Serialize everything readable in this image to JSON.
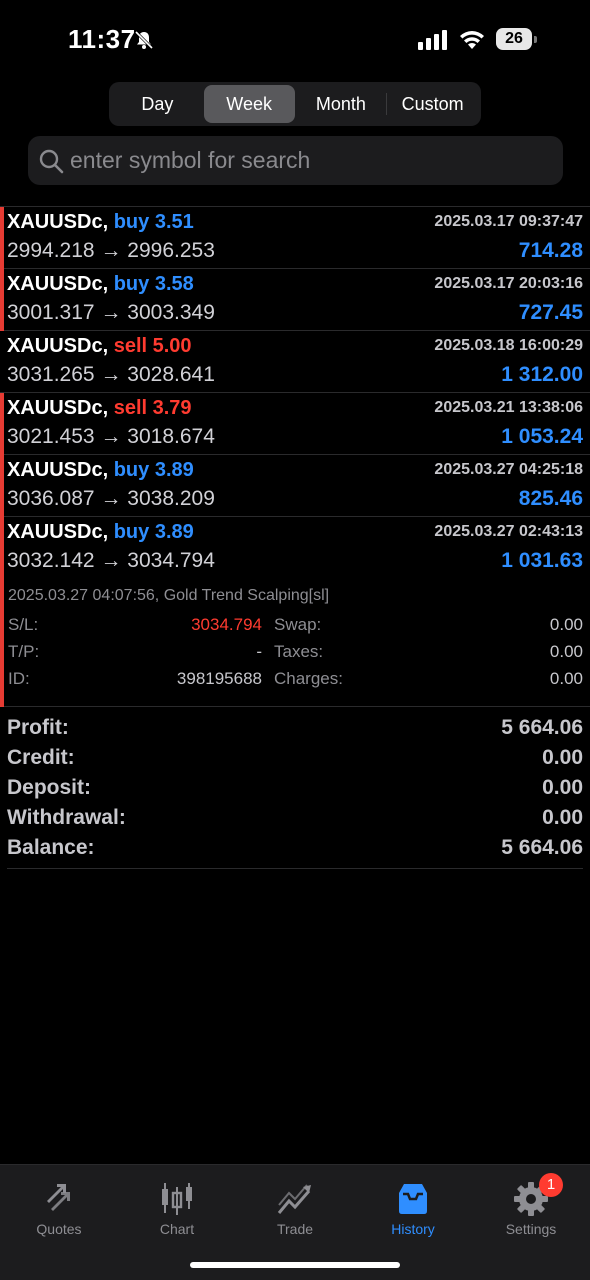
{
  "status_bar": {
    "time": "11:37",
    "battery": "26"
  },
  "segments": [
    {
      "label": "Day",
      "active": false
    },
    {
      "label": "Week",
      "active": true
    },
    {
      "label": "Month",
      "active": false
    },
    {
      "label": "Custom",
      "active": false
    }
  ],
  "search": {
    "placeholder": "enter symbol for search"
  },
  "deals": [
    {
      "symbol": "XAUUSDc,",
      "side": "buy",
      "volume": "3.51",
      "time": "2025.03.17 09:37:47",
      "open": "2994.218",
      "close": "2996.253",
      "arrow": "→",
      "profit": "714.28"
    },
    {
      "symbol": "XAUUSDc,",
      "side": "buy",
      "volume": "3.58",
      "time": "2025.03.17 20:03:16",
      "open": "3001.317",
      "close": "3003.349",
      "arrow": "→",
      "profit": "727.45"
    },
    {
      "symbol": "XAUUSDc,",
      "side": "sell",
      "volume": "5.00",
      "time": "2025.03.18 16:00:29",
      "open": "3031.265",
      "close": "3028.641",
      "arrow": "→",
      "profit": "1 312.00"
    },
    {
      "symbol": "XAUUSDc,",
      "side": "sell",
      "volume": "3.79",
      "time": "2025.03.21 13:38:06",
      "open": "3021.453",
      "close": "3018.674",
      "arrow": "→",
      "profit": "1 053.24"
    },
    {
      "symbol": "XAUUSDc,",
      "side": "buy",
      "volume": "3.89",
      "time": "2025.03.27 04:25:18",
      "open": "3036.087",
      "close": "3038.209",
      "arrow": "→",
      "profit": "825.46"
    },
    {
      "symbol": "XAUUSDc,",
      "side": "buy",
      "volume": "3.89",
      "time": "2025.03.27 02:43:13",
      "open": "3032.142",
      "close": "3034.794",
      "arrow": "→",
      "profit": "1 031.63"
    }
  ],
  "expanded_detail": {
    "comment": "2025.03.27 04:07:56, Gold Trend Scalping[sl]",
    "sl_label": "S/L:",
    "sl_value": "3034.794",
    "tp_label": "T/P:",
    "tp_value": "-",
    "id_label": "ID:",
    "id_value": "398195688",
    "swap_label": "Swap:",
    "swap_value": "0.00",
    "taxes_label": "Taxes:",
    "taxes_value": "0.00",
    "charges_label": "Charges:",
    "charges_value": "0.00"
  },
  "summary": [
    {
      "label": "Profit:",
      "value": "5 664.06"
    },
    {
      "label": "Credit:",
      "value": "0.00"
    },
    {
      "label": "Deposit:",
      "value": "0.00"
    },
    {
      "label": "Withdrawal:",
      "value": "0.00"
    },
    {
      "label": "Balance:",
      "value": "5 664.06"
    }
  ],
  "tabs": [
    {
      "label": "Quotes",
      "icon": "quotes-icon"
    },
    {
      "label": "Chart",
      "icon": "chart-icon"
    },
    {
      "label": "Trade",
      "icon": "trade-icon"
    },
    {
      "label": "History",
      "icon": "history-icon",
      "active": true
    },
    {
      "label": "Settings",
      "icon": "gear-icon",
      "badge": "1"
    }
  ],
  "colors": {
    "buy": "#2f8eff",
    "sell": "#ff3b30",
    "accent": "#2f8eff"
  }
}
